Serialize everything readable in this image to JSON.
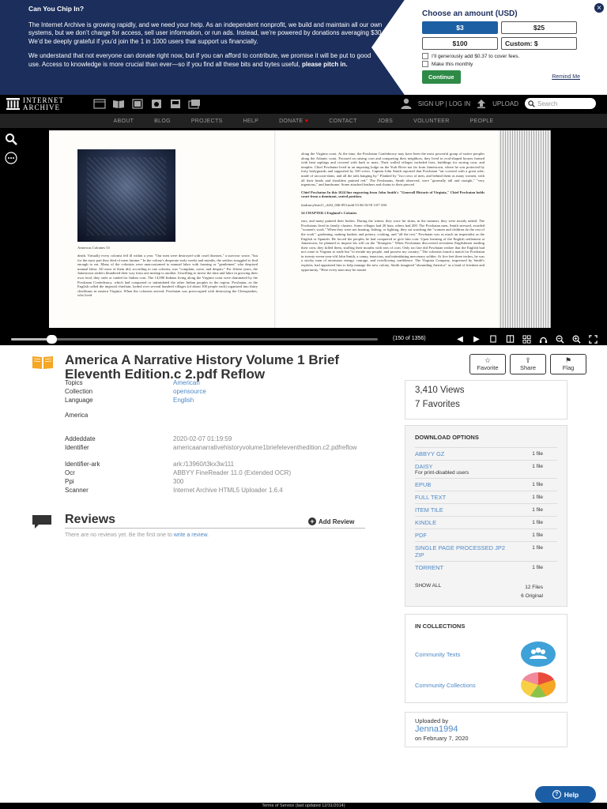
{
  "donation": {
    "heading": "Can You Chip In?",
    "para1": "The Internet Archive is growing rapidly, and we need your help. As an independent nonprofit, we build and maintain all our own systems, but we don’t charge for access, sell user information, or run ads. Instead, we’re powered by donations averaging $30. We’d be deeply grateful if you’d join the 1 in 1000 users that support us financially.",
    "para2": "We understand that not everyone can donate right now, but if you can afford to contribute, we promise it will be put to good use. Access to knowledge is more crucial than ever—so if you find all these bits and bytes useful,",
    "para2_bold": "please pitch in.",
    "panel_title": "Choose an amount (USD)",
    "amounts": [
      "$3",
      "$25",
      "$100"
    ],
    "custom_label": "Custom: $",
    "cover_fees": "I’ll generously add $0.37 to cover fees.",
    "monthly": "Make this monthly",
    "continue": "Continue",
    "remind": "Remind Me",
    "close": "×"
  },
  "nav": {
    "logo_line1": "INTERNET",
    "logo_line2": "ARCHIVE",
    "signup": "SIGN UP | LOG IN",
    "upload": "UPLOAD",
    "search_placeholder": "Search",
    "menu": [
      "ABOUT",
      "BLOG",
      "PROJECTS",
      "HELP",
      "DONATE",
      "CONTACT",
      "JOBS",
      "VOLUNTEER",
      "PEOPLE"
    ]
  },
  "reader": {
    "caption": "Americas Colonies 53",
    "left_text": "death. Virtually every colonist fell ill within a year. \"Our men were destroyed with cruel diseases,\" a survivor wrote, \"but for the most part they died of mere famine.\" In the colony's desperate early weeks and months, the settlers struggled to find enough to eat. Many of the colonists were unaccustomed to manual labor with farming or \"gentlemen\" who despised manual labor. All most of them did, according to one colonist, was \"complain, curse, and despair.\" For fifteen years, the Jamestown settlers blundered their way from one mishap to another. Unwilling to invest the time and labor in growing their own food, they stole or traded for Indian corn. The 14,000 Indians living along the Virginia coast were dominated by the Powhatan Confederacy, which had conquered or intimidated the other Indian peoples in the region. Powhatan, as the English called the imperial chieftain, lorded over several hundred villages (of about 100 people each) organized into thirty chiefdoms in eastern Virginia. When the colonists arrived, Powhatan was preoccupied with destroying the Chesapeakes, who lived",
    "right_text1": "along the Virginia coast. At the time, the Powhatan Confederacy may have been the most powerful group of native peoples along the Atlantic coast. Focused on raising corn and conquering their neighbors, they lived in oval-shaped houses framed with bent saplings and covered with bark or mats. Their walled villages included forts, buildings for storing corn, and temples. Chief Powhatan lived in an imposing lodge on the York River not far from Jamestown, where he was protected by forty bodyguards and supported by 100 wives. Captain John Smith reported that Powhatan \"sat covered with a great robe, made of raccoon-skins, and all the tails hanging by.\" Flanked by \"two rows of men, and behind them as many women, with all their heads and shoulders painted red.\" The Powhatans, Smith observed, were \"generally tall and straight,\" \"very ingenious,\" and handsome. Some attached feathers and chains to their pierced",
    "right_caption": "Chief Powhatan In this 1624 line engraving from John Smith's \"Generall Historie of Virginia,\" Chief Powhatan holds court from a dominant, seated position.",
    "right_file": "tindrmoyhstn11_ch02_046-093.indd 53 06/10/18 3:07 AM",
    "right_chapter": "54 CHAPTER 2 England's Colonies",
    "right_text2": "ears, and many painted their bodies. During the winter, they wore fur skins; in the summer, they were mostly naked. The Powhatans lived in family clusters. Some villages had 20 huts; others had 200. The Powhatan men, Smith stressed, avoided \"women's work.\" When they were not hunting, fishing, or fighting, they sat watching the \"women and children do the rest of the work\": gardening, making baskets and pottery, cooking, and \"all the rest.\" Powhatan was as much an imperialist as the English or Spanish. He forced the peoples he had conquered to give him corn. Upon learning of the English settlement at Jamestown, he planned to impose his will on the \"Strangers.\" When Powhatans discovered seventeen Englishmen stealing their corn, they killed them, stuffing their mouths with ears of corn. Only too late did Powhatan realize that the English had not come to Virginia to trade but \"to invade my people, and possess my country.\" The colonists found a match for Powhatan in twenty-seven-year-old John Smith, a canny, tenacious, and intimidating mercenary soldier. At five feet three inches, he was a stocky man of enormous energy, courage, and overflowing confidence. The Virginia Company, impressed by Smith's exploits, had appointed him to help manage the new colony. Smith imagined \"abounding America\" as a land of freedom and opportunity. \"Here every man may be master",
    "page_count": "(150 of 1356)",
    "progress": 0.11
  },
  "item": {
    "title": "America A Narrative History Volume 1 Brief Eleventh Edition.c 2.pdf Reflow",
    "actions": {
      "favorite": "Favorite",
      "share": "Share",
      "flag": "Flag"
    },
    "topics_label": "Topics",
    "topics_value": "American",
    "collection_label": "Collection",
    "collection_value": "opensource",
    "language_label": "Language",
    "language_value": "English",
    "description": "America",
    "addeddate_label": "Addeddate",
    "addeddate_value": "2020-02-07 01:19:59",
    "identifier_label": "Identifier",
    "identifier_value": "americaanarrativehistoryvolume1briefeleventhedition.c2.pdfreflow",
    "identifier_ark_label": "Identifier-ark",
    "identifier_ark_value": "ark:/13960/t3kx3w111",
    "ocr_label": "Ocr",
    "ocr_value": "ABBYY FineReader 11.0 (Extended OCR)",
    "ppi_label": "Ppi",
    "ppi_value": "300",
    "scanner_label": "Scanner",
    "scanner_value": "Internet Archive HTML5 Uploader 1.6.4"
  },
  "stats": {
    "views": "3,410 Views",
    "favorites": "7 Favorites"
  },
  "downloads": {
    "title": "DOWNLOAD OPTIONS",
    "rows": [
      {
        "name": "ABBYY GZ",
        "count": "1 file",
        "sub": ""
      },
      {
        "name": "DAISY",
        "count": "1 file",
        "sub": "For print-disabled users"
      },
      {
        "name": "EPUB",
        "count": "1 file",
        "sub": ""
      },
      {
        "name": "FULL TEXT",
        "count": "1 file",
        "sub": ""
      },
      {
        "name": "ITEM TILE",
        "count": "1 file",
        "sub": ""
      },
      {
        "name": "KINDLE",
        "count": "1 file",
        "sub": ""
      },
      {
        "name": "PDF",
        "count": "1 file",
        "sub": ""
      },
      {
        "name": "SINGLE PAGE PROCESSED JP2 ZIP",
        "count": "1 file",
        "sub": ""
      },
      {
        "name": "TORRENT",
        "count": "1 file",
        "sub": ""
      }
    ],
    "show_all": "SHOW ALL",
    "files_total": "12 Files",
    "files_original": "6 Original"
  },
  "collections": {
    "title": "IN COLLECTIONS",
    "items": [
      "Community Texts",
      "Community Collections"
    ]
  },
  "uploader": {
    "label": "Uploaded by",
    "name": "Jenna1994",
    "date": "on February 7, 2020"
  },
  "reviews": {
    "title": "Reviews",
    "add": "Add Review",
    "empty": "There are no reviews yet. Be the first one to",
    "empty_link": "write a review",
    "empty_end": "."
  },
  "help": "Help",
  "footer": "Terms of Service (last updated 12/31/2014)",
  "colors": {
    "banner": "#1b2e5c",
    "accent": "#1c5fa3",
    "link": "#4d89c7",
    "continue": "#2e8a46"
  }
}
